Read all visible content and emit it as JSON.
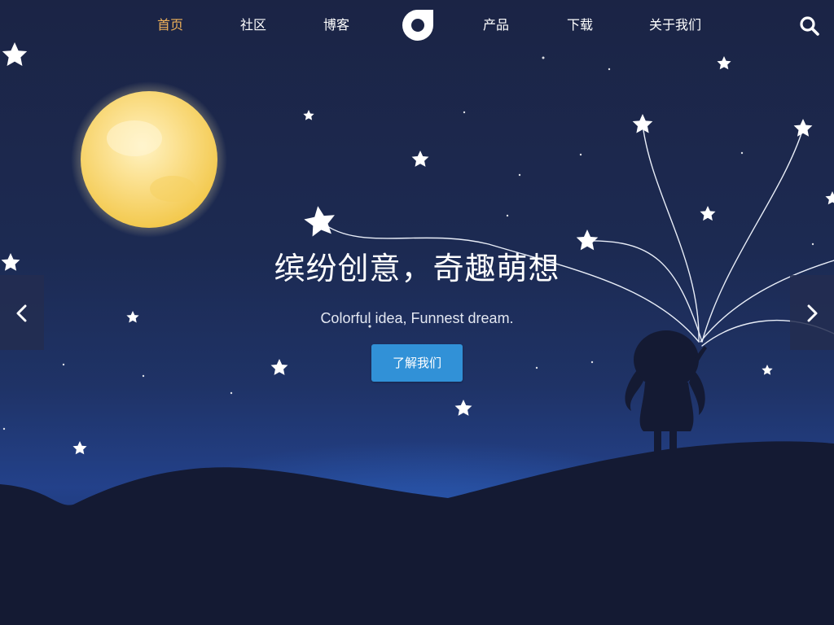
{
  "nav": {
    "items": [
      {
        "label": "首页",
        "active": true
      },
      {
        "label": "社区",
        "active": false
      },
      {
        "label": "博客",
        "active": false
      },
      {
        "label": "产品",
        "active": false
      },
      {
        "label": "下载",
        "active": false
      },
      {
        "label": "关于我们",
        "active": false
      }
    ],
    "logo_icon": "logo-icon",
    "search_icon": "search-icon"
  },
  "hero": {
    "title": "缤纷创意，奇趣萌想",
    "subtitle": "Colorful idea, Funnest dream.",
    "button_label": "了解我们"
  },
  "carousel": {
    "prev_icon": "chevron-left-icon",
    "next_icon": "chevron-right-icon"
  },
  "colors": {
    "nav_active": "#f0b25a",
    "button_bg": "#3191d7",
    "sky_top": "#1b2445",
    "hills": "#141a33",
    "moon": "#f7d774"
  }
}
